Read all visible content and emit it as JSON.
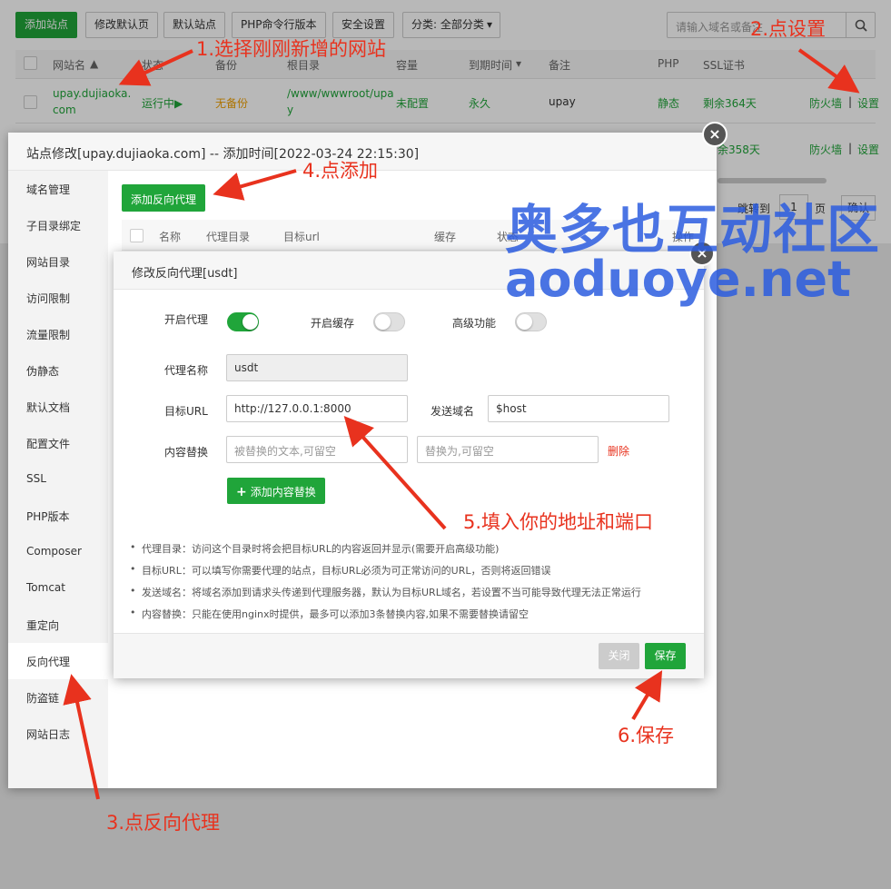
{
  "toolbar": {
    "add_site": "添加站点",
    "edit_default_page": "修改默认页",
    "default_site": "默认站点",
    "php_cli_version": "PHP命令行版本",
    "security_settings": "安全设置",
    "category_select": "分类: 全部分类",
    "search_placeholder": "请输入域名或备注"
  },
  "table": {
    "headers": [
      "网站名",
      "状态",
      "备份",
      "根目录",
      "容量",
      "到期时间",
      "备注",
      "PHP",
      "SSL证书"
    ],
    "rows": [
      {
        "site_line1": "upay.dujiaoka.",
        "site_line2": "com",
        "status": "运行中▶",
        "backup": "无备份",
        "root_line1": "/www/wwwroot/upa",
        "root_line2": "y",
        "capacity": "未配置",
        "expire": "永久",
        "remark": "upay",
        "php": "静态",
        "ssl": "剩余364天",
        "firewall": "防火墙",
        "sep": "|",
        "settings": "设置"
      },
      {
        "ssl": "余358天",
        "firewall": "防火墙",
        "sep": "|",
        "settings": "设置"
      }
    ],
    "pagination": {
      "jump_to": "跳转到",
      "page": "1",
      "page_unit": "页",
      "confirm": "确认"
    }
  },
  "outer_dialog": {
    "title": "站点修改[upay.dujiaoka.com] -- 添加时间[2022-03-24 22:15:30]",
    "side_items": [
      "域名管理",
      "子目录绑定",
      "网站目录",
      "访问限制",
      "流量限制",
      "伪静态",
      "默认文档",
      "配置文件",
      "SSL",
      "PHP版本",
      "Composer",
      "Tomcat",
      "重定向",
      "反向代理",
      "防盗链",
      "网站日志"
    ],
    "active_item": "反向代理",
    "add_proxy_button": "添加反向代理",
    "proxy_table_headers": [
      "名称",
      "代理目录",
      "目标url",
      "缓存",
      "状态",
      "操作"
    ]
  },
  "inner_dialog": {
    "title": "修改反向代理[usdt]",
    "enable_proxy": {
      "label": "开启代理",
      "on": true
    },
    "enable_cache": {
      "label": "开启缓存",
      "on": false
    },
    "advanced": {
      "label": "高级功能",
      "on": false
    },
    "proxy_name_label": "代理名称",
    "proxy_name_value": "usdt",
    "target_url_label": "目标URL",
    "target_url_value": "http://127.0.0.1:8000",
    "send_domain_label": "发送域名",
    "send_domain_value": "$host",
    "content_replace_label": "内容替换",
    "replace_from_placeholder": "被替换的文本,可留空",
    "replace_to_placeholder": "替换为,可留空",
    "delete_label": "删除",
    "add_replace_button": "添加内容替换",
    "tips": [
      "代理目录：访问这个目录时将会把目标URL的内容返回并显示(需要开启高级功能)",
      "目标URL：可以填写你需要代理的站点，目标URL必须为可正常访问的URL，否则将返回错误",
      "发送域名：将域名添加到请求头传递到代理服务器，默认为目标URL域名，若设置不当可能导致代理无法正常运行",
      "内容替换：只能在使用nginx时提供，最多可以添加3条替换内容,如果不需要替换请留空"
    ],
    "close_button": "关闭",
    "save_button": "保存"
  },
  "annotations": {
    "step1": "1.选择刚刚新增的网站",
    "step2": "2.点设置",
    "step3": "3.点反向代理",
    "step4": "4.点添加",
    "step5": "5.填入你的地址和端口",
    "step6": "6.保存"
  },
  "watermark": {
    "line1": "奥多也互动社区",
    "line2": "aoduoye.net"
  },
  "colors": {
    "green": "#20a53a",
    "annotation_red": "#e8321e",
    "watermark_blue": "#2c5de0"
  }
}
